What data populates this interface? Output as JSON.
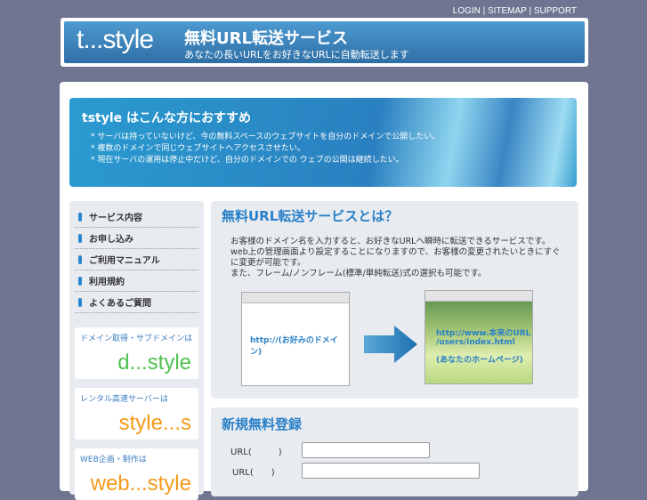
{
  "toplinks": [
    "LOGIN",
    "SITEMAP",
    "SUPPORT"
  ],
  "header": {
    "logo": "t...style",
    "title": "無料URL転送サービス",
    "subtitle": "あなたの長いURLをお好きなURLに自動転送します"
  },
  "banner": {
    "title": "tstyle はこんな方におすすめ",
    "items": [
      "* サーバは持っていないけど、今の無料スペースのウェブサイトを自分のドメインで公開したい。",
      "* 複数のドメインで同じウェブサイトへアクセスさせたい。",
      "* 現在サーバの運用は停止中だけど、自分のドメインでの ウェブの公開は継続したい。"
    ]
  },
  "nav": [
    "サービス内容",
    "お申し込み",
    "ご利用マニュアル",
    "利用規約",
    "よくあるご質問"
  ],
  "ads": [
    {
      "title": "ドメイン取得・サブドメインは",
      "logo": "d...style",
      "color": "#4fc24f"
    },
    {
      "title": "レンタル高速サーバーは",
      "logo": "style...s",
      "color": "#f39a1a"
    },
    {
      "title": "WEB企画・制作は",
      "logo": "web...style",
      "color": "#f39a1a"
    }
  ],
  "about": {
    "title": "無料URL転送サービスとは？",
    "lines": [
      "お客様のドメイン名を入力すると、お好きなURLへ瞬時に転送できるサービスです。",
      "web上の管理画面より設定することになりますので、お客様の変更されたいときにすぐ",
      "に変更が可能です。",
      "また、フレーム/ノンフレーム(標準/単純転送)式の選択も可能です。"
    ],
    "left_label": "http://(お好みのドメイン)",
    "right_label1": "http://www.本来のURL",
    "right_label2": "/users/index.html",
    "right_label3": "(あなたのホームページ)"
  },
  "register": {
    "title": "新規無料登録",
    "field1": "URL(　　　)",
    "field2": "URL(　　)"
  }
}
